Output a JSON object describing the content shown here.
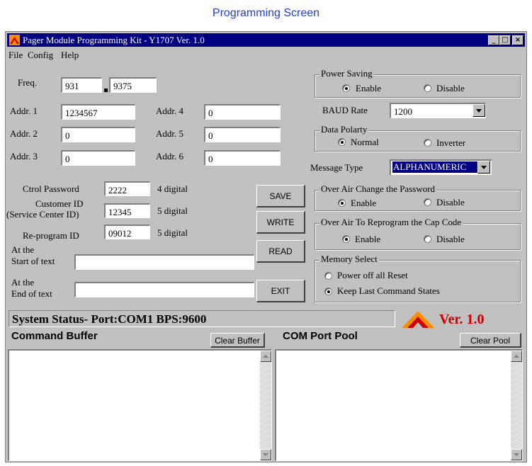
{
  "caption": "Programming Screen",
  "window": {
    "title": "Pager Module Programming Kit - Y1707 Ver. 1.0"
  },
  "menu": {
    "file": "File",
    "config": "Config",
    "help": "Help"
  },
  "freq": {
    "label": "Freq.",
    "main": "931",
    "sep": ".",
    "decimal": "9375"
  },
  "addresses": [
    {
      "label": "Addr. 1",
      "value": "1234567"
    },
    {
      "label": "Addr. 2",
      "value": "0"
    },
    {
      "label": "Addr. 3",
      "value": "0"
    },
    {
      "label": "Addr. 4",
      "value": "0"
    },
    {
      "label": "Addr. 5",
      "value": "0"
    },
    {
      "label": "Addr. 6",
      "value": "0"
    }
  ],
  "ctrl_password": {
    "label": "Ctrol Password",
    "value": "2222",
    "hint": "4 digital"
  },
  "customer_id": {
    "label1": "Customer ID",
    "label2": "(Service Center ID)",
    "value": "12345",
    "hint": "5 digital"
  },
  "reprogram_id": {
    "label": "Re-program ID",
    "value": "09012",
    "hint": "5 digital"
  },
  "start_text": {
    "label1": "At the",
    "label2": "Start of text",
    "value": ""
  },
  "end_text": {
    "label1": "At the",
    "label2": "End of text",
    "value": ""
  },
  "buttons": {
    "save": "SAVE",
    "write": "WRITE",
    "read": "READ",
    "exit": "EXIT"
  },
  "power_saving": {
    "title": "Power Saving",
    "enable": "Enable",
    "disable": "Disable",
    "selected": "enable"
  },
  "baud": {
    "label": "BAUD Rate",
    "value": "1200"
  },
  "polarity": {
    "title": "Data Polarty",
    "normal": "Normal",
    "inverter": "Inverter",
    "selected": "normal"
  },
  "message_type": {
    "label": "Message Type",
    "value": "ALPHANUMERIC"
  },
  "over_air_password": {
    "title": "Over Air Change the Password",
    "enable": "Enable",
    "disable": "Disable",
    "selected": "enable"
  },
  "over_air_capcode": {
    "title": "Over Air To Reprogram the Cap Code",
    "enable": "Enable",
    "disable": "Disable",
    "selected": "enable"
  },
  "memory_select": {
    "title": "Memory Select",
    "option1": "Power off all Reset",
    "option2": "Keep Last Command States",
    "selected": "option2"
  },
  "status": {
    "text": "System Status- Port:COM1 BPS:9600"
  },
  "version": {
    "text": "Ver. 1.0"
  },
  "command_buffer": {
    "title": "Command Buffer",
    "clear_label": "Clear Buffer"
  },
  "com_pool": {
    "title": "COM Port Pool",
    "clear_label": "Clear Pool"
  },
  "colors": {
    "titlebar": "#000080",
    "caption": "#1f3fd6",
    "version_red": "#cc0000",
    "logo_orange": "#ff8c00"
  }
}
